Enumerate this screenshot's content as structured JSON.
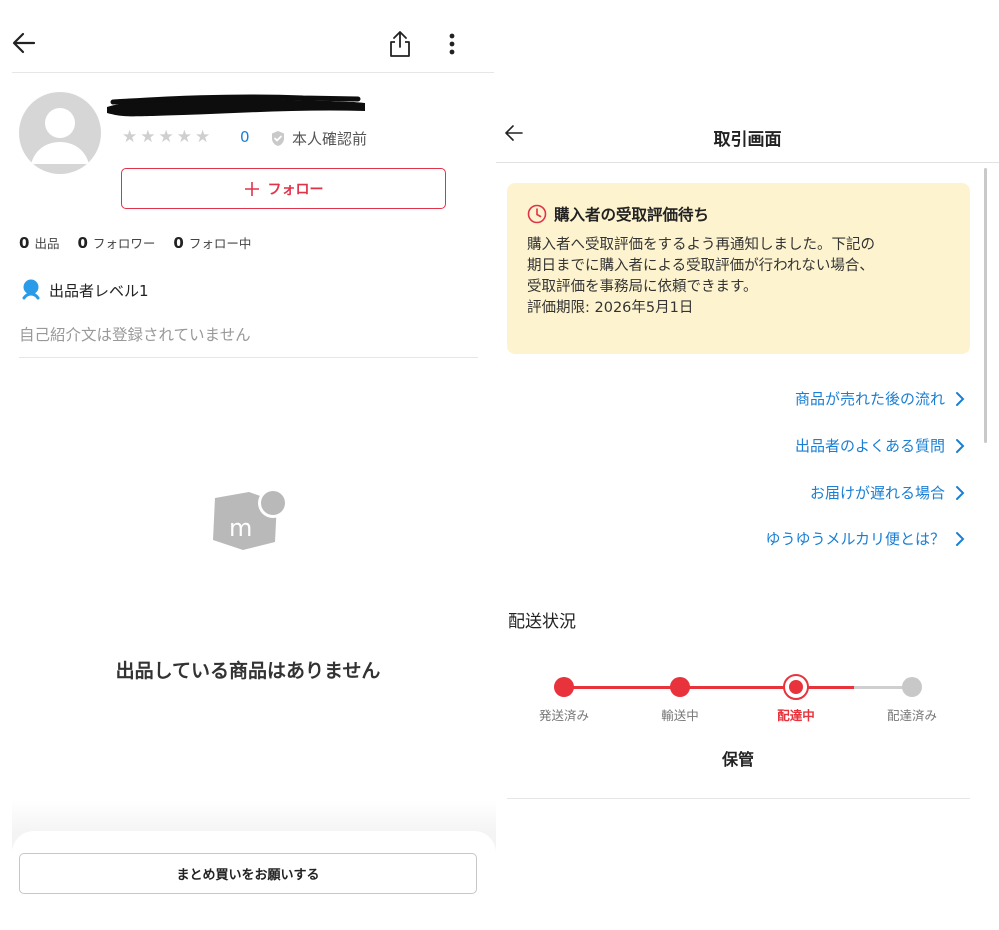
{
  "profile": {
    "rating_count": "0",
    "verification_status": "本人確認前",
    "follow_button_label": "フォロー",
    "stats": [
      {
        "value": "0",
        "label": "出品"
      },
      {
        "value": "0",
        "label": "フォロワー"
      },
      {
        "value": "0",
        "label": "フォロー中"
      }
    ],
    "seller_level": "出品者レベル1",
    "bio_placeholder": "自己紹介文は登録されていません",
    "empty_message": "出品している商品はありません",
    "bundle_button_label": "まとめ買いをお願いする",
    "stars_filled": 0,
    "stars_total": 5
  },
  "transaction": {
    "title": "取引画面",
    "notice": {
      "heading": "購入者の受取評価待ち",
      "lines": [
        "購入者へ受取評価をするよう再通知しました。下記の",
        "期日までに購入者による受取評価が行われない場合、",
        "受取評価を事務局に依頼できます。",
        "評価期限: 2026年5月1日"
      ]
    },
    "links": [
      "商品が売れた後の流れ",
      "出品者のよくある質問",
      "お届けが遅れる場合",
      "ゆうゆうメルカリ便とは？"
    ],
    "shipping_section_title": "配送状況",
    "steps": [
      {
        "label": "発送済み",
        "state": "done"
      },
      {
        "label": "輸送中",
        "state": "done"
      },
      {
        "label": "配達中",
        "state": "current"
      },
      {
        "label": "配達済み",
        "state": "pending"
      }
    ],
    "status_detail": "保管"
  },
  "colors": {
    "accent_red": "#e8323c",
    "link_blue": "#1a7fd4",
    "notice_bg": "#fdf4cf",
    "pending_gray": "#c8c8c8"
  }
}
